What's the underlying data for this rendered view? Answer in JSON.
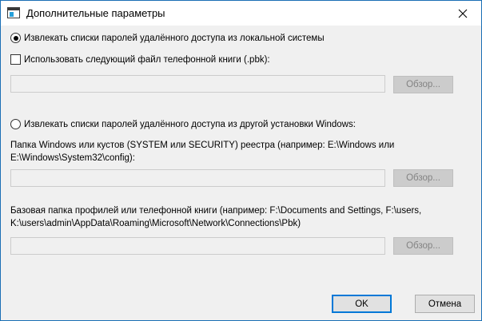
{
  "window": {
    "title": "Дополнительные параметры",
    "close_icon": "close-icon"
  },
  "options": {
    "local_radio_label": "Извлекать списки паролей удалённого доступа из локальной системы",
    "local_radio_checked": true,
    "phonebook_checkbox_label": "Использовать следующий файл телефонной книги (.pbk):",
    "phonebook_checkbox_checked": false,
    "phonebook_path_value": "",
    "browse_label_1": "Обзор...",
    "other_radio_label": "Извлекать списки паролей удалённого доступа из другой установки Windows:",
    "other_radio_checked": false,
    "windows_folder_label_line1": "Папка Windows или кустов (SYSTEM или SECURITY) реестра (например: E:\\Windows или",
    "windows_folder_label_line2": "E:\\Windows\\System32\\config):",
    "windows_folder_value": "",
    "browse_label_2": "Обзор...",
    "profile_folder_label_line1": "Базовая папка профилей или телефонной книги (например: F:\\Documents and Settings, F:\\users,",
    "profile_folder_label_line2": "K:\\users\\admin\\AppData\\Roaming\\Microsoft\\Network\\Connections\\Pbk)",
    "profile_folder_value": "",
    "browse_label_3": "Обзор..."
  },
  "buttons": {
    "ok_label": "OK",
    "cancel_label": "Отмена"
  },
  "colors": {
    "window_border": "#1a6fb5",
    "default_button_border": "#0078d7",
    "disabled_text": "#838383"
  }
}
